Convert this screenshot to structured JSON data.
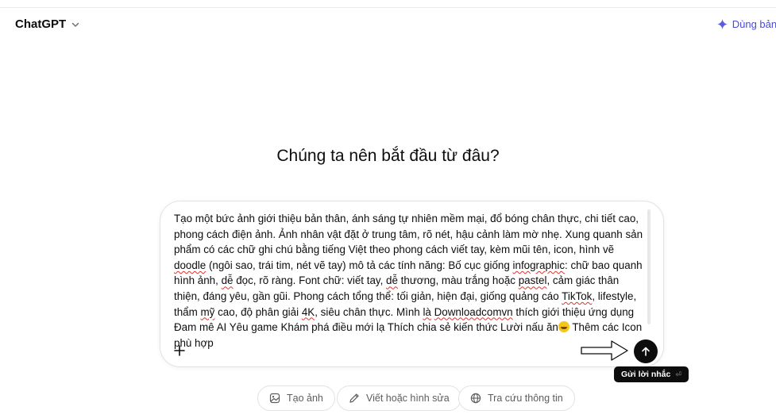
{
  "header": {
    "brand": "ChatGPT",
    "upgrade_label": "Dùng bản Plus"
  },
  "hero": {
    "title": "Chúng ta nên bắt đầu từ đâu?"
  },
  "composer": {
    "segments": [
      {
        "text": "Tạo một bức ảnh giới thiệu bản thân, ánh sáng tự nhiên mềm mại, đổ bóng chân thực, chi tiết cao, phong cách điện ảnh. Ảnh nhân vật đặt ở trung tâm, rõ nét, hậu cảnh làm mờ nhẹ. Xung quanh sản phẩm có các chữ ghi chú bằng tiếng Việt theo phong cách viết tay, kèm mũi tên, icon, hình vẽ "
      },
      {
        "text": "doodle",
        "spell": true
      },
      {
        "text": " (ngôi sao, trái tim, nét vẽ tay) mô tả các tính năng: Bố cục giống "
      },
      {
        "text": "infographic",
        "spell": true
      },
      {
        "text": ": chữ bao quanh hình ảnh, "
      },
      {
        "text": "dễ",
        "spell": true
      },
      {
        "text": " đọc, rõ ràng. Font chữ: viết tay, "
      },
      {
        "text": "dễ",
        "spell": true
      },
      {
        "text": " thương, màu trắng hoặc "
      },
      {
        "text": "pastel",
        "spell": true
      },
      {
        "text": ", cảm giác thân thiện, đáng yêu, gần gũi. Phong cách tổng thể: tối giản, hiện đại, giống quảng cáo "
      },
      {
        "text": "TikTok",
        "spell": true
      },
      {
        "text": ", lifestyle, thẩm "
      },
      {
        "text": "mỹ",
        "spell": true
      },
      {
        "text": " cao, độ phân giải "
      },
      {
        "text": "4K",
        "spell": true
      },
      {
        "text": ", siêu chân thực. Mình "
      },
      {
        "text": "là",
        "spell": true
      },
      {
        "text": " "
      },
      {
        "text": "Downloadcomvn",
        "spell": true
      },
      {
        "text": " thích giới thiệu ứng dụng Đam mê AI Yêu game Khám phá điều mới lạ Thích chia sẻ kiến thức Lười nấu ăn"
      },
      {
        "emoji": "grinning-sweat-emoji"
      },
      {
        "text": " Thêm các Icon phù hợp"
      }
    ],
    "plus_icon": "plus-icon",
    "send_icon": "arrow-up-icon",
    "send_tooltip": "Gửi lời nhắc",
    "send_tooltip_kbd": "⏎"
  },
  "actions": [
    {
      "icon": "image-icon",
      "label": "Tạo ảnh"
    },
    {
      "icon": "pencil-icon",
      "label": "Viết hoặc hình sửa"
    },
    {
      "icon": "globe-icon",
      "label": "Tra cứu thông tin"
    }
  ],
  "colors": {
    "accent": "#4a4ad6",
    "text": "#0d0d0d",
    "muted": "#5d5d5d",
    "spell_underline": "#e0322e"
  }
}
